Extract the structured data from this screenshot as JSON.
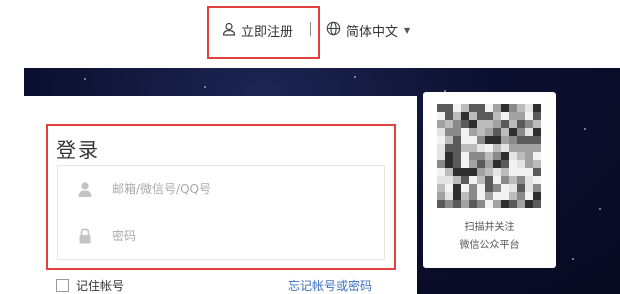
{
  "header": {
    "register_label": "立即注册",
    "language_label": "简体中文"
  },
  "login": {
    "title": "登录",
    "username_placeholder": "邮箱/微信号/QQ号",
    "password_placeholder": "密码",
    "remember_label": "记住帐号",
    "forgot_label": "忘记帐号或密码"
  },
  "qr": {
    "caption_line1": "扫描并关注",
    "caption_line2": "微信公众平台"
  },
  "colors": {
    "highlight": "#e0403e",
    "link": "#3b6fbe",
    "banner": "#0c1030"
  },
  "icons": [
    "user-outline-icon",
    "globe-icon",
    "caret-down-icon",
    "user-icon",
    "lock-icon",
    "qr-code"
  ]
}
